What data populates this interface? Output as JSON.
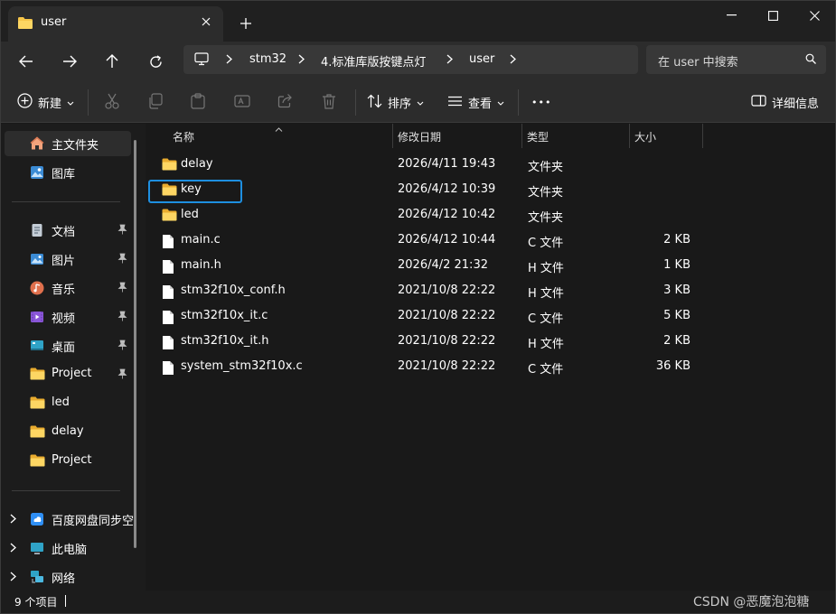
{
  "window": {
    "tab_title": "user",
    "new_tab": "+",
    "minimize": "—",
    "maximize": "☐",
    "close": "✕"
  },
  "address_bar": {
    "breadcrumbs": [
      "stm32",
      "4.标准库版按键点灯",
      "user"
    ],
    "search_placeholder": "在 user 中搜索"
  },
  "command_bar": {
    "new_label": "新建",
    "sort_label": "排序",
    "view_label": "查看",
    "more_label": "•••",
    "details_label": "详细信息"
  },
  "nav_pane": {
    "top_items": [
      {
        "label": "主文件夹",
        "icon": "home-icon"
      },
      {
        "label": "图库",
        "icon": "gallery-icon"
      }
    ],
    "pinned_items": [
      {
        "label": "文档",
        "icon": "document-icon",
        "pinned": true
      },
      {
        "label": "图片",
        "icon": "pictures-icon",
        "pinned": true
      },
      {
        "label": "音乐",
        "icon": "music-icon",
        "pinned": true
      },
      {
        "label": "视频",
        "icon": "video-icon",
        "pinned": true
      },
      {
        "label": "桌面",
        "icon": "desktop-icon",
        "pinned": true
      },
      {
        "label": "Project",
        "icon": "folder-icon",
        "pinned": true
      },
      {
        "label": "led",
        "icon": "folder-icon",
        "pinned": false
      },
      {
        "label": "delay",
        "icon": "folder-icon",
        "pinned": false
      },
      {
        "label": "Project",
        "icon": "folder-icon",
        "pinned": false
      }
    ],
    "bottom_items": [
      {
        "label": "百度网盘同步空",
        "icon": "baidu-sync-icon"
      },
      {
        "label": "此电脑",
        "icon": "computer-icon"
      },
      {
        "label": "网络",
        "icon": "network-icon"
      }
    ]
  },
  "file_list": {
    "columns": [
      "名称",
      "修改日期",
      "类型",
      "大小"
    ],
    "rows": [
      {
        "name": "delay",
        "date": "2026/4/11 19:43",
        "type": "文件夹",
        "size": "",
        "kind": "folder"
      },
      {
        "name": "key",
        "date": "2026/4/12 10:39",
        "type": "文件夹",
        "size": "",
        "kind": "folder"
      },
      {
        "name": "led",
        "date": "2026/4/12 10:42",
        "type": "文件夹",
        "size": "",
        "kind": "folder"
      },
      {
        "name": "main.c",
        "date": "2026/4/12 10:44",
        "type": "C 文件",
        "size": "2 KB",
        "kind": "file"
      },
      {
        "name": "main.h",
        "date": "2026/4/2 21:32",
        "type": "H 文件",
        "size": "1 KB",
        "kind": "file"
      },
      {
        "name": "stm32f10x_conf.h",
        "date": "2021/10/8 22:22",
        "type": "H 文件",
        "size": "3 KB",
        "kind": "file"
      },
      {
        "name": "stm32f10x_it.c",
        "date": "2021/10/8 22:22",
        "type": "C 文件",
        "size": "5 KB",
        "kind": "file"
      },
      {
        "name": "stm32f10x_it.h",
        "date": "2021/10/8 22:22",
        "type": "H 文件",
        "size": "2 KB",
        "kind": "file"
      },
      {
        "name": "system_stm32f10x.c",
        "date": "2021/10/8 22:22",
        "type": "C 文件",
        "size": "36 KB",
        "kind": "file"
      }
    ]
  },
  "status_bar": {
    "item_count": "9 个项目",
    "watermark": "CSDN @恶魔泡泡糖"
  },
  "colors": {
    "folder": "#f7c64a",
    "highlight": "#1e8fe0",
    "background": "#191919",
    "toolbar": "#2c2c2c"
  }
}
